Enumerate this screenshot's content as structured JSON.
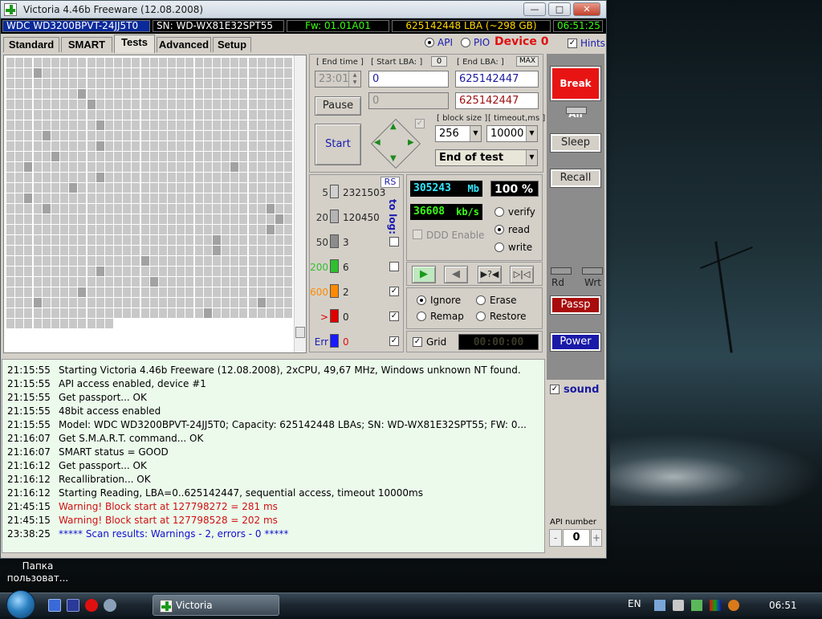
{
  "window": {
    "title": "Victoria 4.46b Freeware (12.08.2008)"
  },
  "infobar": {
    "model": "WDC WD3200BPVT-24JJ5T0",
    "serial": "SN: WD-WX81E32SPT55",
    "firmware": "Fw: 01.01A01",
    "capacity": "625142448 LBA (~298 GB)",
    "clock": "06:51:25"
  },
  "tabs": [
    "Standard",
    "SMART",
    "Tests",
    "Advanced",
    "Setup"
  ],
  "mode": {
    "api_label": "API",
    "pio_label": "PIO",
    "device_label": "Device 0",
    "hints_label": "Hints"
  },
  "test_panel": {
    "end_time_label": "[ End time ]",
    "end_time_value": "23:01",
    "start_lba_label": "[ Start LBA: ]",
    "start_lba_zero": "0",
    "end_lba_label": "[ End LBA: ]",
    "max_label": "MAX",
    "start_lba_value": "0",
    "end_lba_value": "625142447",
    "current_lba_value": "0",
    "current_end_lba_value": "625142447",
    "pause_label": "Pause",
    "start_label": "Start",
    "block_size_label": "[ block size ]",
    "block_size_value": "256",
    "timeout_label": "[ timeout,ms ]",
    "timeout_value": "10000",
    "end_action_value": "End of test"
  },
  "histogram": {
    "rs_label": "RS",
    "to_log_label": "to log:",
    "rows": [
      {
        "label": "5",
        "count": "2321503",
        "color": "#d0d0d0"
      },
      {
        "label": "20",
        "count": "120450",
        "color": "#b4b4b4"
      },
      {
        "label": "50",
        "count": "3",
        "color": "#8c8c8c"
      },
      {
        "label": "200",
        "count": "6",
        "color": "#2fbf2f"
      },
      {
        "label": "600",
        "count": "2",
        "color": "#ff8a00"
      },
      {
        "label": ">",
        "count": "0",
        "color": "#e00000"
      },
      {
        "label": "Err",
        "count": "0",
        "color": "#1a1aff"
      }
    ]
  },
  "stats": {
    "position_value": "305243",
    "position_unit": "Mb",
    "percent_value": "100",
    "percent_unit": "%",
    "speed_value": "36608",
    "speed_unit": "kb/s",
    "ddd_label": "DDD Enable",
    "verify_label": "verify",
    "read_label": "read",
    "write_label": "write"
  },
  "error_actions": {
    "ignore_label": "Ignore",
    "erase_label": "Erase",
    "remap_label": "Remap",
    "restore_label": "Restore",
    "grid_label": "Grid",
    "timer_value": "00:00:00"
  },
  "log": [
    {
      "time": "21:15:55",
      "text": "Starting Victoria 4.46b Freeware (12.08.2008), 2xCPU, 49,67 MHz, Windows unknown NT found.",
      "color": "#000000"
    },
    {
      "time": "21:15:55",
      "text": "API access enabled, device #1",
      "color": "#000000"
    },
    {
      "time": "21:15:55",
      "text": "Get passport... OK",
      "color": "#000000"
    },
    {
      "time": "21:15:55",
      "text": "48bit access enabled",
      "color": "#000000"
    },
    {
      "time": "21:15:55",
      "text": "Model: WDC WD3200BPVT-24JJ5T0; Capacity: 625142448 LBAs; SN: WD-WX81E32SPT55; FW: 0...",
      "color": "#000000"
    },
    {
      "time": "21:16:07",
      "text": "Get S.M.A.R.T. command... OK",
      "color": "#000000"
    },
    {
      "time": "21:16:07",
      "text": "SMART status = GOOD",
      "color": "#000000"
    },
    {
      "time": "21:16:12",
      "text": "Get passport... OK",
      "color": "#000000"
    },
    {
      "time": "21:16:12",
      "text": "Recallibration... OK",
      "color": "#000000"
    },
    {
      "time": "21:16:12",
      "text": "Starting Reading, LBA=0..625142447, sequential access, timeout 10000ms",
      "color": "#000000"
    },
    {
      "time": "21:45:15",
      "text": "Warning! Block start at 127798272 = 281 ms",
      "color": "#d01010"
    },
    {
      "time": "21:45:15",
      "text": "Warning! Block start at 127798528 = 202 ms",
      "color": "#d01010"
    },
    {
      "time": "23:38:25",
      "text": "***** Scan results: Warnings - 2, errors - 0 *****",
      "color": "#1010d0"
    }
  ],
  "side_panel": {
    "break_all_label": "Break All",
    "sleep_label": "Sleep",
    "recall_label": "Recall",
    "rd_label": "Rd",
    "wrt_label": "Wrt",
    "passp_label": "Passp",
    "power_label": "Power",
    "sound_label": "sound",
    "api_number_label": "API number",
    "api_number_value": "0",
    "minus_label": "-",
    "plus_label": "+"
  },
  "desktop": {
    "folder_label_1": "Папка",
    "folder_label_2": "пользоват..."
  },
  "taskbar": {
    "task_label": "Victoria",
    "lang": "EN",
    "clock": "06:51"
  }
}
